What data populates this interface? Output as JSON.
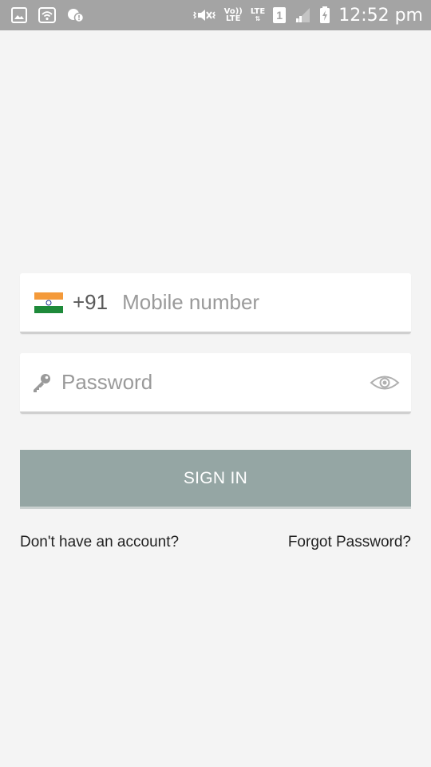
{
  "status_bar": {
    "time": "12:52 pm",
    "volte_top": "Vo))",
    "volte_bottom": "LTE",
    "lte_label": "LTE",
    "sim_slot": "1",
    "icons": [
      "gallery-icon",
      "wifi-icon",
      "messenger-icon",
      "vibrate-icon",
      "volte-icon",
      "lte-icon",
      "sim-icon",
      "signal-icon",
      "battery-charging-icon"
    ],
    "bar_color": "#a4a4a4"
  },
  "login": {
    "country_flag": "india-flag-icon",
    "country_code": "+91",
    "mobile_placeholder": "Mobile number",
    "mobile_value": "",
    "password_placeholder": "Password",
    "password_value": "",
    "sign_in_label": "SIGN IN",
    "sign_in_color": "#95a6a4",
    "no_account_label": "Don't have an account?",
    "forgot_password_label": "Forgot Password?"
  }
}
